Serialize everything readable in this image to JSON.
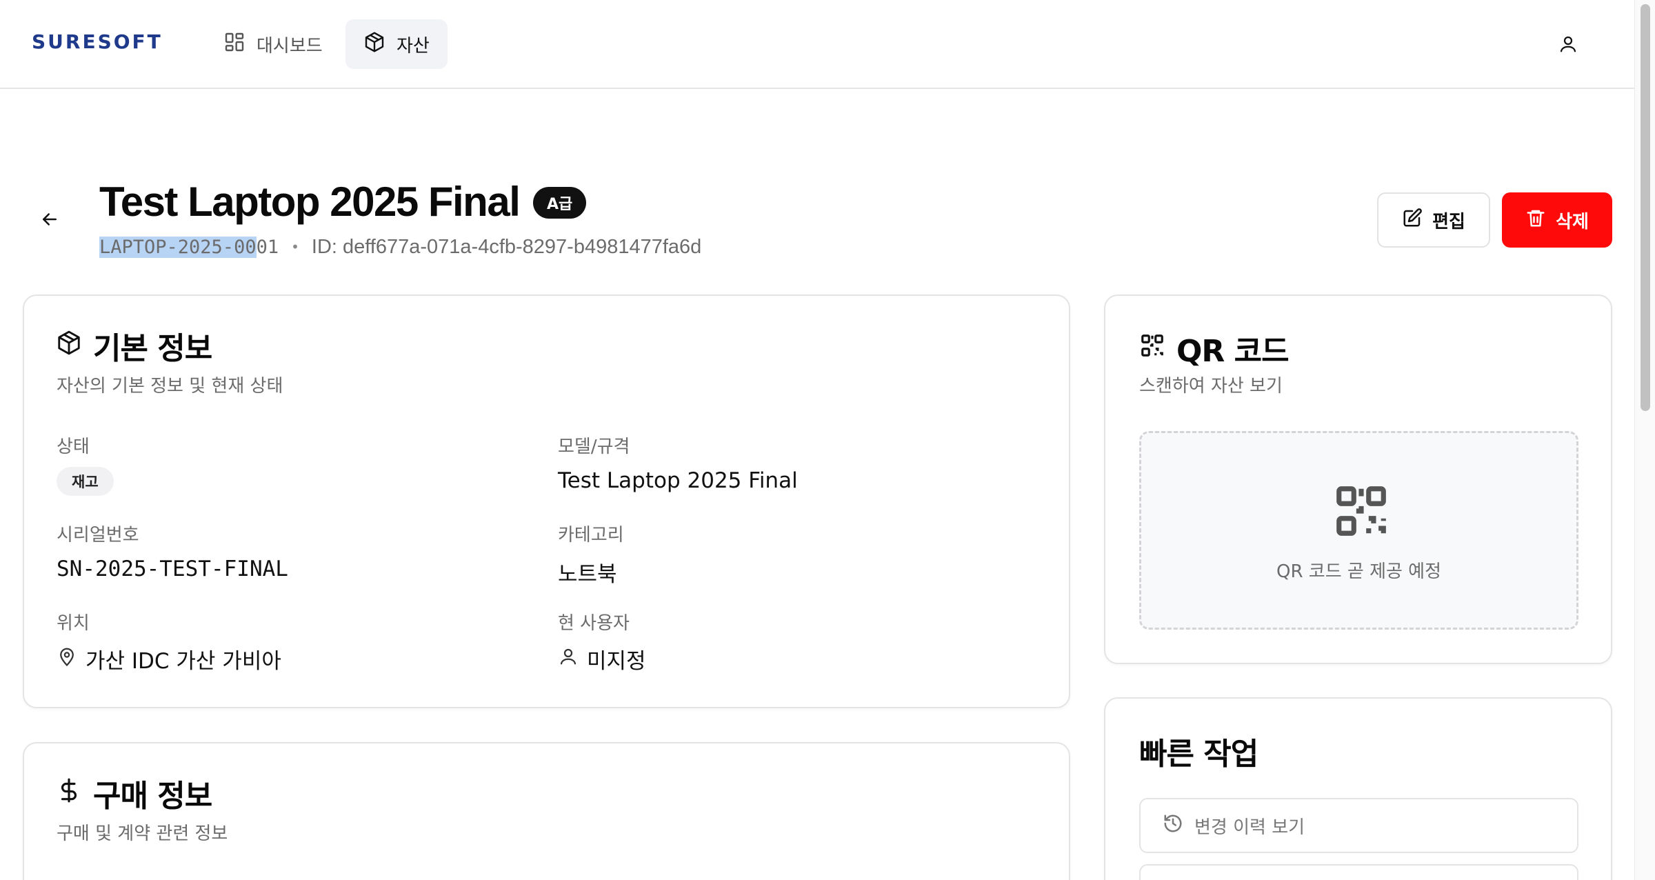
{
  "header": {
    "logo_text": "SURESOFT",
    "nav": [
      {
        "label": "대시보드",
        "icon": "dashboard-icon",
        "active": false
      },
      {
        "label": "자산",
        "icon": "package-icon",
        "active": true
      }
    ],
    "user_icon": "user-icon"
  },
  "page": {
    "title": "Test Laptop 2025 Final",
    "grade_badge": "A급",
    "asset_code": "LAPTOP-2025-0001",
    "asset_code_selected": "LAPTOP-2025-00",
    "asset_code_rest": "01",
    "separator": "•",
    "asset_id": "ID: deff677a-071a-4cfb-8297-b4981477fa6d",
    "edit_label": "편집",
    "delete_label": "삭제"
  },
  "basic_info": {
    "title": "기본 정보",
    "description": "자산의 기본 정보 및 현재 상태",
    "status_label": "상태",
    "status_value": "재고",
    "model_label": "모델/규격",
    "model_value": "Test Laptop 2025 Final",
    "serial_label": "시리얼번호",
    "serial_value": "SN-2025-TEST-FINAL",
    "category_label": "카테고리",
    "category_value": "노트북",
    "location_label": "위치",
    "location_value": "가산 IDC 가산 가비아",
    "user_label": "현 사용자",
    "user_value": "미지정"
  },
  "purchase_info": {
    "title": "구매 정보",
    "description": "구매 및 계약 관련 정보"
  },
  "qr": {
    "title": "QR 코드",
    "description": "스캔하여 자산 보기",
    "placeholder": "QR 코드 곧 제공 예정"
  },
  "quick_actions": {
    "title": "빠른 작업",
    "items": [
      {
        "label": "변경 이력 보기",
        "icon": "history-icon"
      },
      {
        "label": "",
        "icon": ""
      }
    ]
  },
  "colors": {
    "danger": "#ff0a0a",
    "badge_dark": "#111111",
    "selection": "#b8d4f5",
    "logo": "#1f3a8a"
  }
}
